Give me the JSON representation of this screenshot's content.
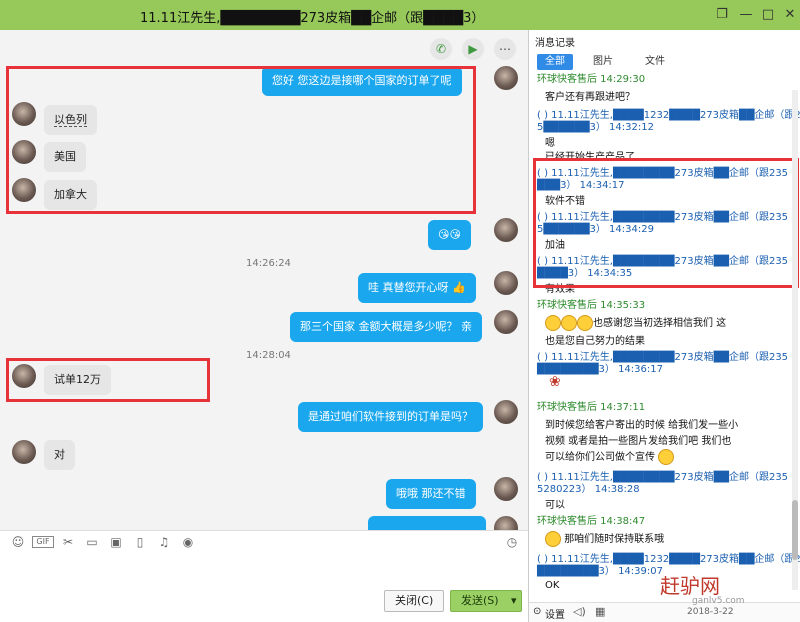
{
  "window": {
    "title": "11.11江先生,████████273皮箱██企邮（跟████3）",
    "min_glyph": "—",
    "max_glyph": "□",
    "close_glyph": "✕",
    "pin_glyph": "❐"
  },
  "chat": {
    "messages": [
      {
        "side": "right",
        "text": "您好  您这边是接哪个国家的订单了呢"
      },
      {
        "side": "left",
        "text": "以色列"
      },
      {
        "side": "left",
        "text": "美国"
      },
      {
        "side": "left",
        "text": "加拿大"
      },
      {
        "side": "right",
        "text": "😘😘"
      },
      {
        "side": "time",
        "text": "14:26:24"
      },
      {
        "side": "right",
        "text": "哇  真替您开心呀 👍"
      },
      {
        "side": "right",
        "text": "那三个国家 金额大概是多少呢？ 亲"
      },
      {
        "side": "time",
        "text": "14:28:04"
      },
      {
        "side": "left",
        "text": "试单12万"
      },
      {
        "side": "right",
        "text": "是通过咱们软件接到的订单是吗？"
      },
      {
        "side": "left",
        "text": "对"
      },
      {
        "side": "right",
        "text": "哦哦  那还不错"
      }
    ]
  },
  "composer": {
    "close_label": "关闭(C)",
    "send_label": "发送(S)"
  },
  "panel": {
    "title": "消息记录",
    "tabs": [
      "全部",
      "图片",
      "文件"
    ],
    "entries": {
      "e0_sender": "环球快客售后 14:29:30",
      "e0_msg": "客户还有再跟进吧？",
      "e1_meta_a": "(    ) 11.11江先生,████1232████273皮箱██企邮（跟235",
      "e1_meta_b": "5██████3）  14:32:12",
      "e1_msg_a": "嗯",
      "e1_msg_b": "已经开始生产产品了",
      "e2_meta_a": "(    ) 11.11江先生,████████273皮箱██企邮（跟235",
      "e2_meta_b": "███3）  14:34:17",
      "e2_msg": "软件不错",
      "e3_meta_a": "(    ) 11.11江先生,████████273皮箱██企邮（跟235",
      "e3_meta_b": "5██████3）  14:34:29",
      "e3_msg": "加油",
      "e4_meta_a": "(    ) 11.11江先生,████████273皮箱██企邮（跟235",
      "e4_meta_b": "████3）  14:34:35",
      "e4_msg": "有效果",
      "e5_sender": "环球快客售后 14:35:33",
      "e5_msg_a": "也感谢您当初选择相信我们   这",
      "e5_msg_b": "也是您自己努力的结果",
      "e6_meta_a": "(    ) 11.11江先生,████████273皮箱██企邮（跟235",
      "e6_meta_b": "████████3）  14:36:17",
      "e7_sender": "环球快客售后 14:37:11",
      "e7_msg_a": "到时候您给客户寄出的时候  给我们发一些小",
      "e7_msg_b": "视频  或者是拍一些图片发给我们吧   我们也",
      "e7_msg_c": "可以给你们公司做个宣传",
      "e8_meta_a": "(    ) 11.11江先生,████████273皮箱██企邮（跟235",
      "e8_meta_b": "5280223）  14:38:28",
      "e8_msg": "可以",
      "e9_sender": "环球快客售后 14:38:47",
      "e9_msg": "那咱们随时保持联系哦",
      "e10_meta_a": "(    ) 11.11江先生,████1232████273皮箱██企邮（跟235",
      "e10_meta_b": "████████3）  14:39:07",
      "e10_msg": "OK"
    },
    "bottom_settings": "设置",
    "bottom_date": "2018-3-22"
  },
  "watermark": {
    "main": "赶驴网",
    "sub": "ganlv5.com"
  },
  "colors": {
    "titlebar": "#97c95a",
    "bubble_right": "#1ba7ee",
    "bubble_left": "#e6e6e6",
    "annotation_red": "#e8323a",
    "send_button": "#9bd064",
    "tab_active": "#2f8be6"
  }
}
